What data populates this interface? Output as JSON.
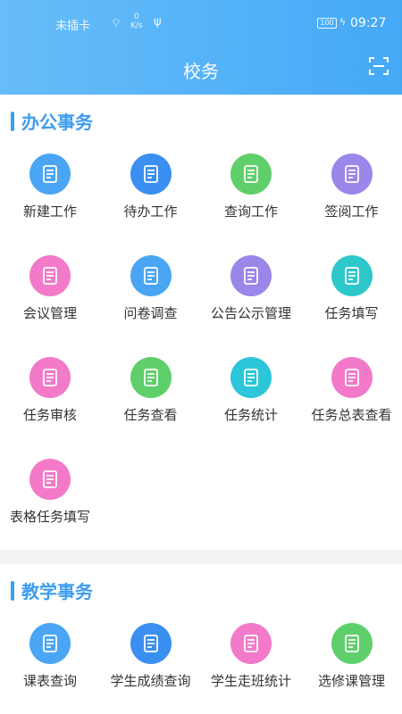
{
  "status_bar": {
    "carrier": "未插卡",
    "speed_value": "0",
    "speed_unit": "K/s",
    "battery": "100",
    "time": "09:27"
  },
  "header": {
    "title": "校务"
  },
  "office": {
    "title": "办公事务",
    "items": [
      {
        "label": "新建工作",
        "color": "#4aa6f4",
        "icon": "folder-plus-icon"
      },
      {
        "label": "待办工作",
        "color": "#3a8ff0",
        "icon": "pending-doc-icon"
      },
      {
        "label": "查询工作",
        "color": "#5fcf6b",
        "icon": "search-doc-icon"
      },
      {
        "label": "签阅工作",
        "color": "#9b86ea",
        "icon": "sign-doc-icon"
      },
      {
        "label": "会议管理",
        "color": "#f27ac9",
        "icon": "meeting-people-icon"
      },
      {
        "label": "问卷调查",
        "color": "#4aa6f4",
        "icon": "questionnaire-icon"
      },
      {
        "label": "公告公示管理",
        "color": "#9b86ea",
        "icon": "notice-board-icon"
      },
      {
        "label": "任务填写",
        "color": "#2dc7c9",
        "icon": "task-edit-icon"
      },
      {
        "label": "任务审核",
        "color": "#f27ac9",
        "icon": "task-review-icon"
      },
      {
        "label": "任务查看",
        "color": "#5fcf6b",
        "icon": "task-view-icon"
      },
      {
        "label": "任务统计",
        "color": "#2bc6d9",
        "icon": "pie-chart-icon"
      },
      {
        "label": "任务总表查看",
        "color": "#f27ac9",
        "icon": "task-summary-icon"
      },
      {
        "label": "表格任务填写",
        "color": "#f27ac9",
        "icon": "form-task-icon"
      }
    ]
  },
  "teaching": {
    "title": "教学事务",
    "items": [
      {
        "label": "课表查询",
        "color": "#4aa6f4",
        "icon": "timetable-search-icon"
      },
      {
        "label": "学生成绩查询",
        "color": "#3a8ff0",
        "icon": "grade-search-icon"
      },
      {
        "label": "学生走班统计",
        "color": "#f27ac9",
        "icon": "calendar-stats-icon"
      },
      {
        "label": "选修课管理",
        "color": "#5fcf6b",
        "icon": "elective-book-icon"
      }
    ]
  }
}
